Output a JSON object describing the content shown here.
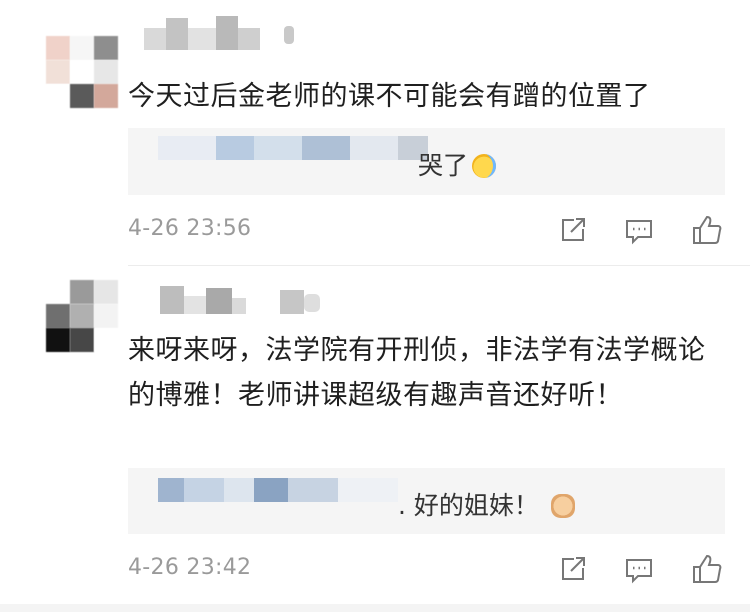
{
  "comments": [
    {
      "text": "今天过后金老师的课不可能会有蹭的位置了",
      "reply": {
        "text": "哭了",
        "emoji": "crying-laughing-face"
      },
      "timestamp": "4-26 23:56"
    },
    {
      "text": "来呀来呀，法学院有开刑侦，非法学有法学概论的博雅！老师讲课超级有趣声音还好听！",
      "reply": {
        "text": ". 好的姐妹！",
        "emoji": "fist-emoji"
      },
      "timestamp": "4-26 23:42"
    }
  ],
  "icons": {
    "share": "share-icon",
    "comment": "comment-icon",
    "like": "thumbs-up-icon"
  },
  "colors": {
    "background": "#ffffff",
    "reply_background": "#f5f5f5",
    "meta_text": "#9a9a9a",
    "body_text": "#1f1f1f"
  }
}
